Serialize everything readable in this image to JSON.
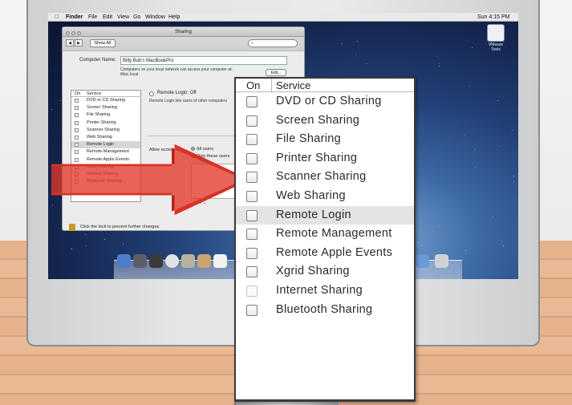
{
  "menubar": {
    "apple": "",
    "items": [
      "Finder",
      "File",
      "Edit",
      "View",
      "Go",
      "Window",
      "Help"
    ],
    "clock": "Sun 4:15 PM"
  },
  "vmware": {
    "label": "VMware Tools"
  },
  "window": {
    "title": "Sharing",
    "show_all": "Show All",
    "computer_name_label": "Computer Name:",
    "computer_name_value": "Billy Bob's MacBookPro",
    "computer_name_note": "Computers on your local network can access your computer at: iMac.local",
    "edit_button": "Edit...",
    "list_header": {
      "on": "On",
      "service": "Service"
    },
    "services": [
      "DVD or CD Sharing",
      "Screen Sharing",
      "File Sharing",
      "Printer Sharing",
      "Scanner Sharing",
      "Web Sharing",
      "Remote Login",
      "Remote Management",
      "Remote Apple Events",
      "Xgrid Sharing",
      "Internet Sharing",
      "Bluetooth Sharing"
    ],
    "selected_index": 6,
    "remote_login_status": "Remote Login: Off",
    "remote_login_desc": "Remote Login lets users of other computers",
    "allow_access_label": "Allow access for:",
    "option_all": "All users",
    "option_only": "Only these users",
    "plus_minus": "+  −",
    "lock_text": "Click the lock to prevent further changes."
  },
  "zoom_panel": {
    "header_on": "On",
    "header_service": "Service",
    "rows": [
      {
        "label": "DVD or CD Sharing",
        "selected": false,
        "dim": false
      },
      {
        "label": "Screen Sharing",
        "selected": false,
        "dim": false
      },
      {
        "label": "File Sharing",
        "selected": false,
        "dim": false
      },
      {
        "label": "Printer Sharing",
        "selected": false,
        "dim": false
      },
      {
        "label": "Scanner Sharing",
        "selected": false,
        "dim": false
      },
      {
        "label": "Web Sharing",
        "selected": false,
        "dim": false
      },
      {
        "label": "Remote Login",
        "selected": true,
        "dim": false
      },
      {
        "label": "Remote Management",
        "selected": false,
        "dim": false
      },
      {
        "label": "Remote Apple Events",
        "selected": false,
        "dim": false
      },
      {
        "label": "Xgrid Sharing",
        "selected": false,
        "dim": false
      },
      {
        "label": "Internet Sharing",
        "selected": false,
        "dim": true
      },
      {
        "label": "Bluetooth Sharing",
        "selected": false,
        "dim": false
      }
    ]
  },
  "colors": {
    "arrow": "#e2382c",
    "selection": "#e4e4e4",
    "accent": "#2a5fb8"
  },
  "icons": [
    "apple-icon",
    "vmware-tools-icon",
    "lock-icon",
    "search-icon",
    "arrow-pointer-icon",
    "monitor-logo-icon"
  ]
}
